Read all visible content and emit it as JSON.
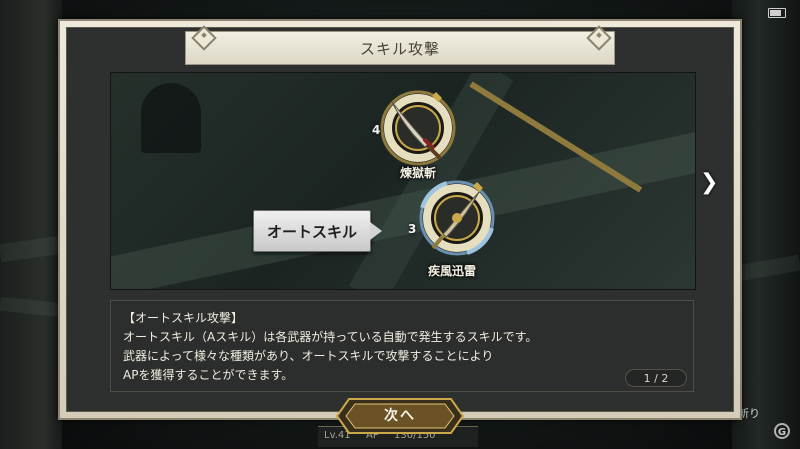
{
  "dialog": {
    "title": "スキル攻撃",
    "next_button": "次へ",
    "page_indicator": "1 / 2"
  },
  "skills": [
    {
      "name": "煉獄斬",
      "level": "4",
      "icon": "crimson-sword-icon"
    },
    {
      "name": "疾風迅雷",
      "level": "3",
      "icon": "ornate-sword-icon"
    }
  ],
  "callout": {
    "label": "オートスキル"
  },
  "description": {
    "heading": "【オートスキル攻撃】",
    "lines": [
      "オートスキル（Aスキル）は各武器が持っている自動で発生するスキルです。",
      "武器によって様々な種類があり、オートスキルで攻撃することにより",
      "APを獲得することができます。"
    ]
  },
  "hud": {
    "right_label": "斬り",
    "bottom_left": "Lv.41",
    "bottom_mid": "AP",
    "bottom_value": "130/150"
  },
  "colors": {
    "gold": "#c9a94a",
    "ring_light": "#e8e2c8",
    "parchment": "#e4dfcf",
    "panel_dark": "#2c2e2d"
  }
}
